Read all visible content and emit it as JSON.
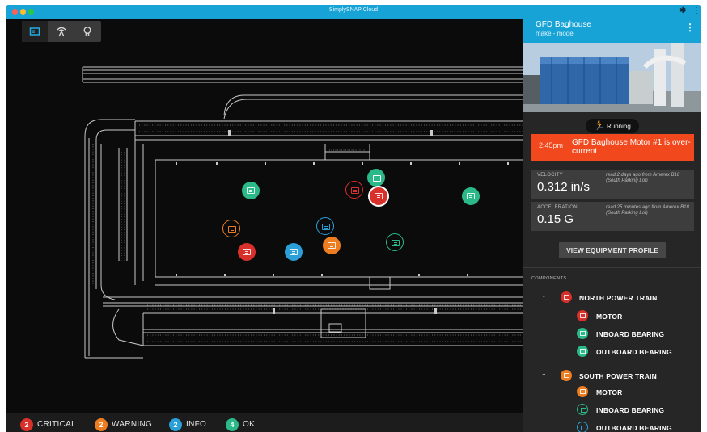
{
  "window": {
    "title": "SimplySNAP Cloud"
  },
  "map_toolbar": {
    "buttons": [
      "sensor",
      "antenna",
      "light"
    ]
  },
  "legend": [
    {
      "count": "2",
      "label": "CRITICAL",
      "color": "#d8302b"
    },
    {
      "count": "2",
      "label": "WARNING",
      "color": "#ec7d20"
    },
    {
      "count": "2",
      "label": "INFO",
      "color": "#2a9fd8"
    },
    {
      "count": "4",
      "label": "OK",
      "color": "#2bb98a"
    }
  ],
  "panel": {
    "title": "GFD Baghouse",
    "subtitle": "make - model",
    "status": "Running",
    "alert": {
      "time": "2:45pm",
      "message": "GFD Baghouse Motor #1 is over-current"
    },
    "metrics": [
      {
        "label": "VELOCITY",
        "value": "0.312 in/s",
        "note": "read 2 days ago from Amerex B18 (South Parking Lot)"
      },
      {
        "label": "ACCELERATION",
        "value": "0.15 G",
        "note": "read 25 minutes ago from Amerex B18 (South Parking Lot)"
      }
    ],
    "view_button": "VIEW EQUIPMENT PROFILE",
    "components_title": "COMPONENTS",
    "components": [
      {
        "name": "NORTH POWER TRAIN",
        "color": "#d8302b",
        "children": [
          {
            "name": "MOTOR",
            "color": "#d8302b",
            "style": "fill"
          },
          {
            "name": "INBOARD BEARING",
            "color": "#2bb98a",
            "style": "fill"
          },
          {
            "name": "OUTBOARD BEARING",
            "color": "#2bb98a",
            "style": "fill"
          }
        ]
      },
      {
        "name": "SOUTH POWER TRAIN",
        "color": "#ec7d20",
        "children": [
          {
            "name": "MOTOR",
            "color": "#ec7d20",
            "style": "fill"
          },
          {
            "name": "INBOARD BEARING",
            "color": "#2bb98a",
            "style": "ring"
          },
          {
            "name": "OUTBOARD BEARING",
            "color": "#2a9fd8",
            "style": "ring"
          }
        ]
      }
    ]
  }
}
